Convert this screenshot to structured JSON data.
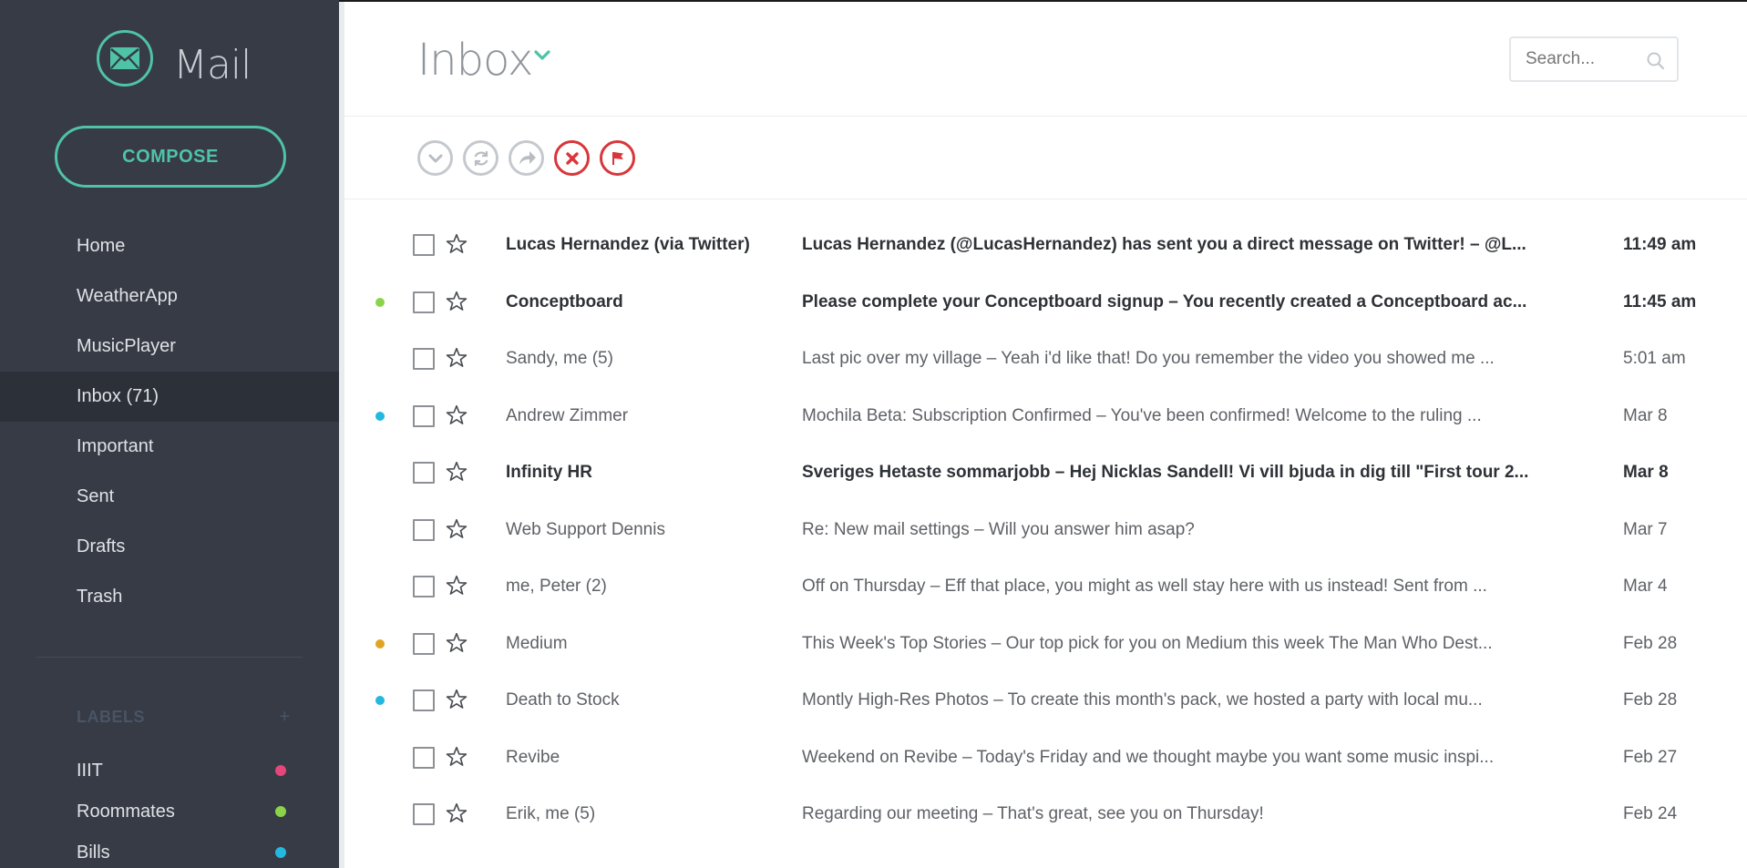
{
  "app": {
    "brand_name": "Mail",
    "compose_label": "COMPOSE",
    "accent_color": "#4fc3a6",
    "sidebar_bg": "#363b45"
  },
  "sidebar": {
    "nav": [
      {
        "label": "Home",
        "active": false
      },
      {
        "label": "WeatherApp",
        "active": false
      },
      {
        "label": "MusicPlayer",
        "active": false
      },
      {
        "label": "Inbox (71)",
        "active": true
      },
      {
        "label": "Important",
        "active": false
      },
      {
        "label": "Sent",
        "active": false
      },
      {
        "label": "Drafts",
        "active": false
      },
      {
        "label": "Trash",
        "active": false
      }
    ],
    "labels_title": "LABELS",
    "labels_add": "+",
    "labels": [
      {
        "label": "IIIT",
        "color": "#e8457a"
      },
      {
        "label": "Roommates",
        "color": "#8bd44a"
      },
      {
        "label": "Bills",
        "color": "#22b8e0"
      }
    ]
  },
  "main": {
    "title": "Inbox",
    "search_placeholder": "Search...",
    "toolbar": [
      {
        "name": "select-all-icon",
        "variant": "grey"
      },
      {
        "name": "refresh-icon",
        "variant": "grey"
      },
      {
        "name": "forward-icon",
        "variant": "grey"
      },
      {
        "name": "delete-icon",
        "variant": "red"
      },
      {
        "name": "flag-icon",
        "variant": "red"
      }
    ],
    "emails": [
      {
        "sender": "Lucas Hernandez (via Twitter)",
        "subject": "Lucas Hernandez (@LucasHernandez) has sent you a direct message on Twitter!  –  @L...",
        "time": "11:49 am",
        "unread": true,
        "dot": ""
      },
      {
        "sender": "Conceptboard",
        "subject": "Please complete your Conceptboard signup  –  You recently created a Conceptboard ac...",
        "time": "11:45 am",
        "unread": true,
        "dot": "#8bd44a"
      },
      {
        "sender": "Sandy, me (5)",
        "subject": "Last pic over my village  –  Yeah i'd like that! Do you remember the video you showed me ...",
        "time": "5:01 am",
        "unread": false,
        "dot": ""
      },
      {
        "sender": "Andrew Zimmer",
        "subject": "Mochila Beta: Subscription Confirmed  –  You've been confirmed! Welcome to the ruling ...",
        "time": "Mar 8",
        "unread": false,
        "dot": "#22b8e0"
      },
      {
        "sender": "Infinity HR",
        "subject": "Sveriges Hetaste sommarjobb  –  Hej Nicklas Sandell! Vi vill bjuda in dig till \"First tour 2...",
        "time": "Mar 8",
        "unread": true,
        "dot": ""
      },
      {
        "sender": "Web Support Dennis",
        "subject": "Re: New mail settings  –  Will you answer him asap?",
        "time": "Mar 7",
        "unread": false,
        "dot": ""
      },
      {
        "sender": "me, Peter (2)",
        "subject": "Off on Thursday  –  Eff that place, you might as well stay here with us instead! Sent from ...",
        "time": "Mar 4",
        "unread": false,
        "dot": ""
      },
      {
        "sender": "Medium",
        "subject": "This Week's Top Stories  –  Our top pick for you on Medium this week The Man Who Dest...",
        "time": "Feb 28",
        "unread": false,
        "dot": "#e0a420"
      },
      {
        "sender": "Death to Stock",
        "subject": "Montly High-Res Photos  –  To create this month's pack, we hosted a party with local mu...",
        "time": "Feb 28",
        "unread": false,
        "dot": "#22b8e0"
      },
      {
        "sender": "Revibe",
        "subject": "Weekend on Revibe  –  Today's Friday and we thought maybe you want some music inspi...",
        "time": "Feb 27",
        "unread": false,
        "dot": ""
      },
      {
        "sender": "Erik, me (5)",
        "subject": "Regarding our meeting  –  That's great, see you on Thursday!",
        "time": "Feb 24",
        "unread": false,
        "dot": ""
      }
    ]
  }
}
